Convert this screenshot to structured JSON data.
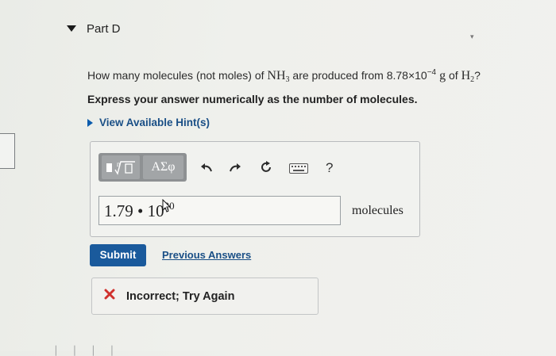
{
  "part": {
    "title": "Part D"
  },
  "question": {
    "prefix": "How many molecules (not moles) of ",
    "nh3": "NH",
    "nh3_sub": "3",
    "middle": " are produced from 8.78×10",
    "exponent": "−4",
    "g": " g",
    "of": " of ",
    "h2": "H",
    "h2_sub": "2",
    "end": "?"
  },
  "instruction": "Express your answer numerically as the number of molecules.",
  "hint": {
    "label": "View Available Hint(s)"
  },
  "toolbar": {
    "greek_label": "ΑΣφ",
    "help_label": "?",
    "icons": [
      "template-icon",
      "radical-icon",
      "undo-icon",
      "redo-icon",
      "reset-icon",
      "keyboard-icon",
      "help-icon"
    ]
  },
  "answer": {
    "mantissa": "1.79 • 10",
    "exponent": "20",
    "units": "molecules"
  },
  "buttons": {
    "submit": "Submit",
    "previous_answers": "Previous Answers"
  },
  "feedback": {
    "text": "Incorrect; Try Again",
    "color": "#d0312d"
  },
  "colors": {
    "accent": "#1a5a9c",
    "link": "#1a4f86"
  }
}
